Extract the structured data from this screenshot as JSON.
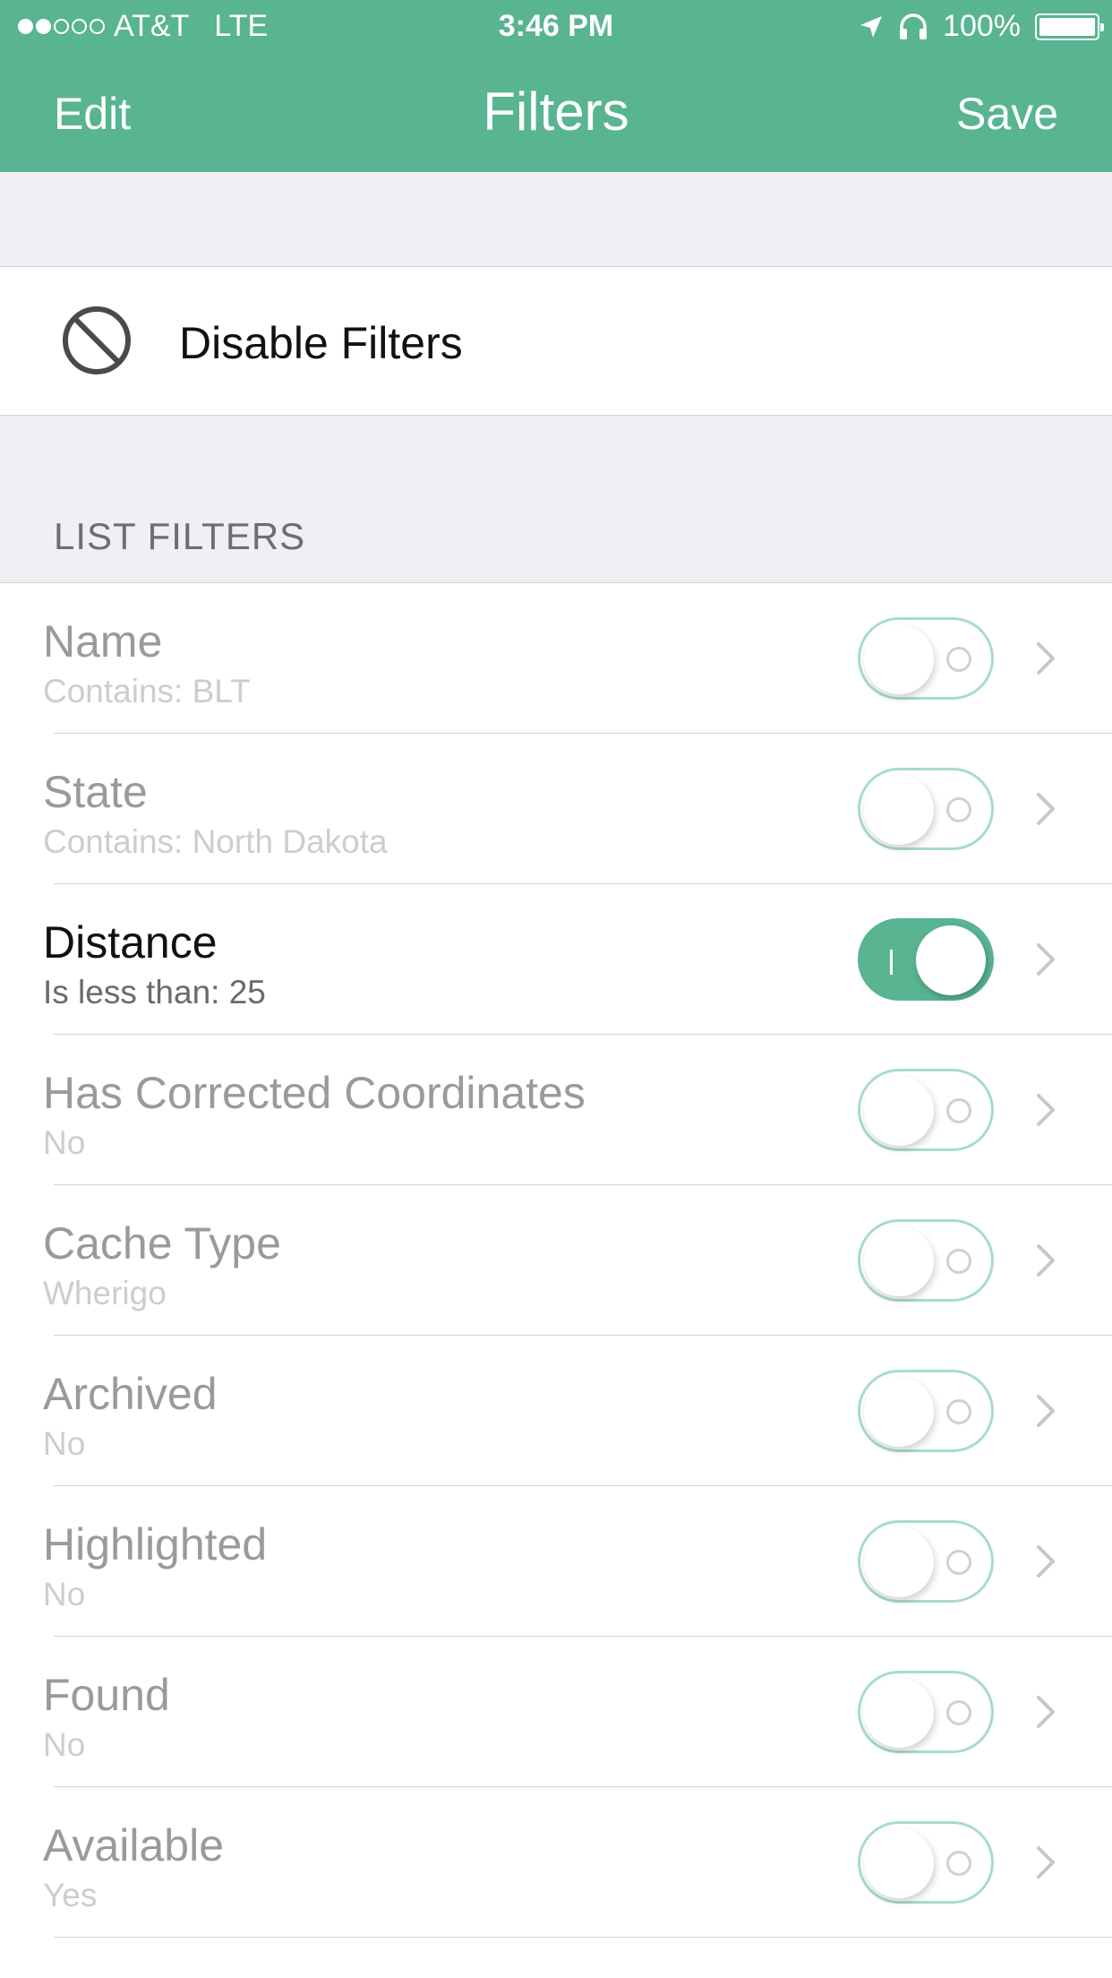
{
  "status_bar": {
    "signal_filled": 2,
    "signal_total": 5,
    "carrier": "AT&T",
    "network": "LTE",
    "time": "3:46 PM",
    "battery": "100%",
    "icons": [
      "location-arrow-icon",
      "headphones-icon",
      "battery-icon"
    ]
  },
  "nav": {
    "edit_label": "Edit",
    "title": "Filters",
    "save_label": "Save"
  },
  "disable": {
    "label": "Disable Filters",
    "icon": "ban-icon"
  },
  "section": {
    "header": "LIST FILTERS"
  },
  "filters": [
    {
      "title": "Name",
      "subtitle": "Contains: BLT",
      "enabled": false
    },
    {
      "title": "State",
      "subtitle": "Contains: North Dakota",
      "enabled": false
    },
    {
      "title": "Distance",
      "subtitle": "Is less than: 25",
      "enabled": true
    },
    {
      "title": "Has Corrected Coordinates",
      "subtitle": "No",
      "enabled": false
    },
    {
      "title": "Cache Type",
      "subtitle": "Wherigo",
      "enabled": false
    },
    {
      "title": "Archived",
      "subtitle": "No",
      "enabled": false
    },
    {
      "title": "Highlighted",
      "subtitle": "No",
      "enabled": false
    },
    {
      "title": "Found",
      "subtitle": "No",
      "enabled": false
    },
    {
      "title": "Available",
      "subtitle": "Yes",
      "enabled": false
    }
  ],
  "colors": {
    "accent": "#58b491",
    "toggle_off_border": "#a8dcc7",
    "background": "#efeff4"
  }
}
